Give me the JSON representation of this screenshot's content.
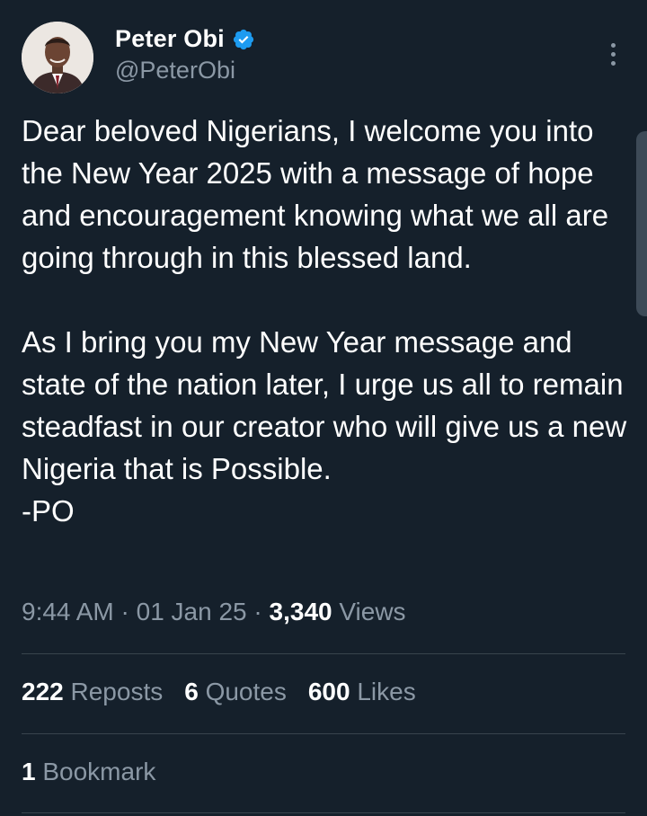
{
  "author": {
    "display_name": "Peter Obi",
    "handle": "@PeterObi",
    "verified": true,
    "avatar_icon": "profile-photo"
  },
  "tweet": {
    "text": "Dear beloved Nigerians, I welcome you into the New Year 2025 with a message of hope and encouragement knowing what we all are going through in this blessed land.\n\nAs I bring you my New Year message and state of the nation later, I urge us all to remain steadfast in our creator who will give us a new Nigeria that is Possible.\n-PO",
    "time": "9:44 AM",
    "date": "01 Jan 25",
    "separator": "·",
    "views_count": "3,340",
    "views_label": "Views"
  },
  "stats": {
    "reposts_count": "222",
    "reposts_label": "Reposts",
    "quotes_count": "6",
    "quotes_label": "Quotes",
    "likes_count": "600",
    "likes_label": "Likes",
    "bookmarks_count": "1",
    "bookmarks_label": "Bookmark"
  },
  "colors": {
    "background": "#15202b",
    "text_primary": "#ffffff",
    "text_secondary": "#8b98a5",
    "divider": "#38444d",
    "verified_badge": "#1d9bf0"
  },
  "icons": {
    "verified": "verified-badge-icon",
    "more": "more-vertical-icon"
  }
}
